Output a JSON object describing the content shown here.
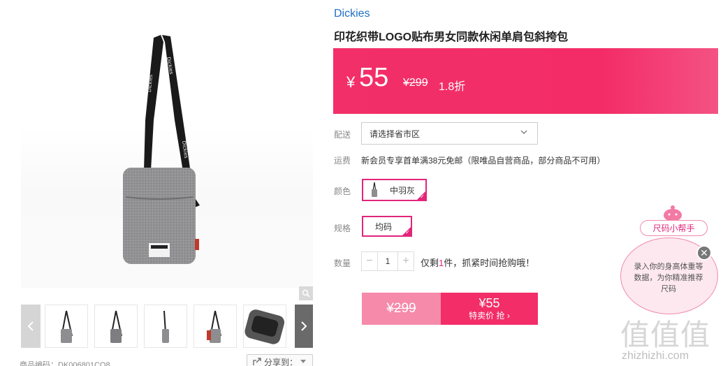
{
  "product": {
    "brand": "Dickies",
    "title": "印花织带LOGO贴布男女同款休闲单肩包斜挎包",
    "currency": "¥",
    "price_now": "55",
    "price_old": "¥299",
    "discount": "1.8折"
  },
  "delivery": {
    "label": "配送",
    "placeholder": "请选择省市区"
  },
  "shipping": {
    "label": "运费",
    "text": "新会员专享首单满38元免邮（限唯品自营商品，部分商品不可用）"
  },
  "color": {
    "label": "颜色",
    "selected": "中羽灰"
  },
  "size": {
    "label": "规格",
    "selected": "均码"
  },
  "quantity": {
    "label": "数量",
    "value": "1",
    "stock_prefix": "仅剩",
    "stock_count": "1",
    "stock_suffix": "件，抓紧时间抢购哦！"
  },
  "buy": {
    "old_price": "¥299",
    "new_price": "¥55",
    "action": "特卖价 抢"
  },
  "gallery": {
    "thumbnail_count": 5
  },
  "footer": {
    "sku_text": "商品编码：DK006801CO8",
    "share_label": "分享到："
  },
  "size_helper": {
    "tag": "尺码小帮手",
    "text": "录入你的身高体重等数据，为你精准推荐尺码"
  },
  "watermark": {
    "logo": "值值值",
    "url": "zhizhizhi.com"
  },
  "colors": {
    "accent": "#f22d67",
    "brand_link": "#1f6fc5",
    "selected_border": "#e2257a"
  }
}
